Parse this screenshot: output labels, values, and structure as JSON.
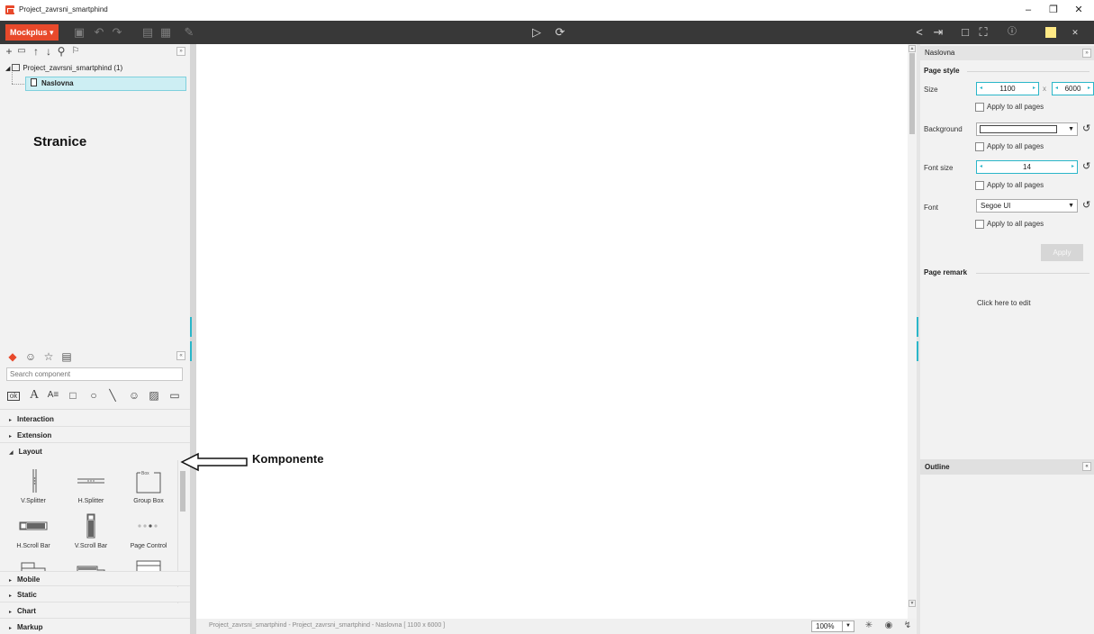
{
  "window": {
    "title": "Project_zavrsni_smartphind",
    "minimize_glyph": "–",
    "restore_glyph": "❐",
    "close_glyph": "✕"
  },
  "toolbar": {
    "brand_label": "Mockplus ▾",
    "icons": [
      "save-icon",
      "undo-icon",
      "redo-icon",
      "group-icon",
      "ungroup-icon",
      "brush-icon",
      "preview-play-icon",
      "sync-icon",
      "share-icon",
      "export-icon",
      "frame-icon",
      "fullscreen-icon",
      "help-icon",
      "note-icon",
      "close-icon"
    ]
  },
  "left_panel": {
    "tree_root_label": "Project_zavrsni_smartphind (1)",
    "tree_item_label": "Naslovna",
    "annotation_pages": "Stranice",
    "search_placeholder": "Search component",
    "categories_top": [
      {
        "label": "Interaction",
        "expanded": false
      },
      {
        "label": "Extension",
        "expanded": false
      },
      {
        "label": "Layout",
        "expanded": true
      }
    ],
    "components": [
      {
        "name": "V.Splitter",
        "icon": "vsplitter-icon"
      },
      {
        "name": "H.Splitter",
        "icon": "hsplitter-icon"
      },
      {
        "name": "Group Box",
        "icon": "groupbox-icon"
      },
      {
        "name": "H.Scroll Bar",
        "icon": "hscrollbar-icon"
      },
      {
        "name": "V.Scroll Bar",
        "icon": "vscrollbar-icon"
      },
      {
        "name": "Page Control",
        "icon": "pagecontrol-icon"
      }
    ],
    "group_box_caption": "Box",
    "categories_bottom": [
      {
        "label": "Mobile"
      },
      {
        "label": "Static"
      },
      {
        "label": "Chart"
      },
      {
        "label": "Markup"
      }
    ]
  },
  "canvas": {
    "annotation_components": "Komponente"
  },
  "statusbar": {
    "text": "Project_zavrsni_smartphind - Project_zavrsni_smartphind - Naslovna [ 1100 x 6000 ]",
    "zoom": "100%"
  },
  "right_panel": {
    "page_name": "Naslovna",
    "page_style_title": "Page style",
    "size_label": "Size",
    "width_value": "1100",
    "height_value": "6000",
    "times": "x",
    "background_label": "Background",
    "background_color": "#ffffff",
    "font_size_label": "Font size",
    "font_size_value": "14",
    "font_label": "Font",
    "font_value": "Segoe UI",
    "apply_all_label": "Apply to all pages",
    "apply_button": "Apply",
    "page_remark_title": "Page remark",
    "edit_placeholder": "Click here to edit",
    "outline_title": "Outline"
  },
  "colors": {
    "accent": "#2ab6c9",
    "brand": "#e8492b",
    "toolbar_bg": "#383838",
    "panel_bg": "#f2f2f2"
  }
}
